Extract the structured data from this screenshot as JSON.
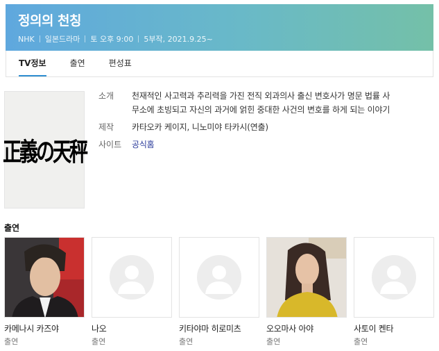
{
  "program": {
    "title": "정의의 천칭",
    "meta": [
      "NHK",
      "일본드라마",
      "토 오후 9:00",
      "5부작, 2021.9.25~"
    ]
  },
  "tabs": [
    {
      "label": "TV정보",
      "active": true
    },
    {
      "label": "출연",
      "active": false
    },
    {
      "label": "편성표",
      "active": false
    }
  ],
  "poster": {
    "text": "正義の天秤"
  },
  "info": {
    "synopsis_label": "소개",
    "synopsis_line1": "천재적인 사고력과 추리력을 가진 전직 외과의사 출신 변호사가 명문 법률 사",
    "synopsis_line2": "무소에 초빙되고 자신의 과거에 얽힌 중대한 사건의 변호를 하게 되는 이야기",
    "production_label": "제작",
    "production_value": "카타오카 케이지, 니노미야 타카시(연출)",
    "site_label": "사이트",
    "site_value": "공식홈"
  },
  "cast": {
    "heading": "출연",
    "members": [
      {
        "name": "카메나시 카즈야",
        "role": "출연",
        "photo": "person-photo"
      },
      {
        "name": "나오",
        "role": "출연",
        "photo": "placeholder"
      },
      {
        "name": "키타야마 히로미츠",
        "role": "출연",
        "photo": "placeholder"
      },
      {
        "name": "오오마사 아야",
        "role": "출연",
        "photo": "person-photo"
      },
      {
        "name": "사토이 켄타",
        "role": "출연",
        "photo": "placeholder"
      }
    ]
  },
  "colors": {
    "header_start": "#5fa8de",
    "header_end": "#74c0a8",
    "tab_indicator": "#2f8fd1",
    "link": "#2a3a9a"
  }
}
